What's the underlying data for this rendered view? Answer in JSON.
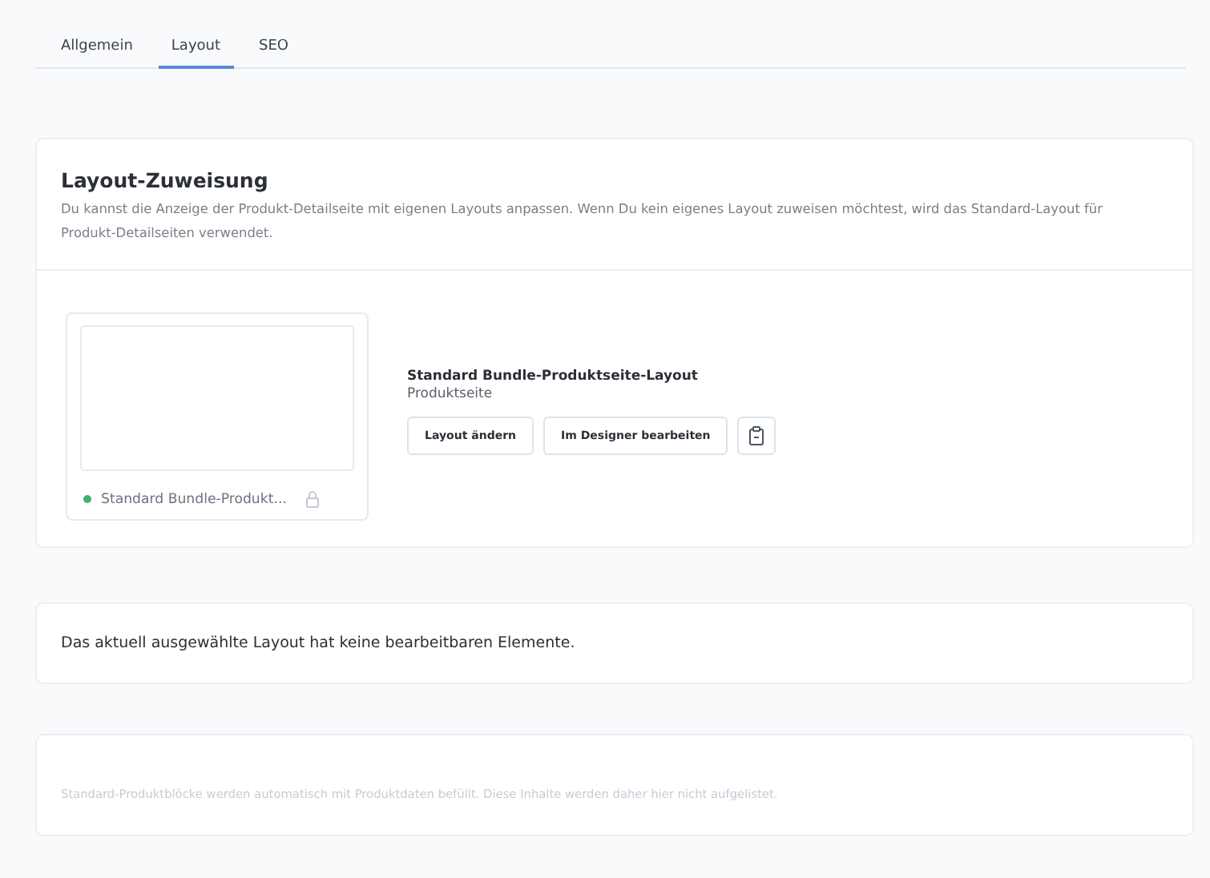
{
  "tabs": [
    {
      "label": "Allgemein",
      "selected": false
    },
    {
      "label": "Layout",
      "selected": true
    },
    {
      "label": "SEO",
      "selected": false
    }
  ],
  "assignment": {
    "title": "Layout-Zuweisung",
    "description": "Du kannst die Anzeige der Produkt-Detailseite mit eigenen Layouts anpassen. Wenn Du kein eigenes Layout zuweisen möchtest, wird das Standard-Layout für Produkt-Detailseiten verwendet.",
    "preview": {
      "name": "Standard Bundle-Produkt...",
      "color": "#3fb36b",
      "locked": true
    },
    "layout_name": "Standard Bundle-Produktseite-Layout",
    "layout_type": "Produktseite",
    "buttons": [
      "Layout ändern",
      "Im Designer bearbeiten"
    ]
  },
  "notice": "Das aktuell ausgewählte Layout hat keine bearbeitbaren Elemente.",
  "hint": "Standard-Produktblöcke werden automatisch mit Produktdaten befüllt. Diese Inhalte werden daher hier nicht aufgelistet."
}
